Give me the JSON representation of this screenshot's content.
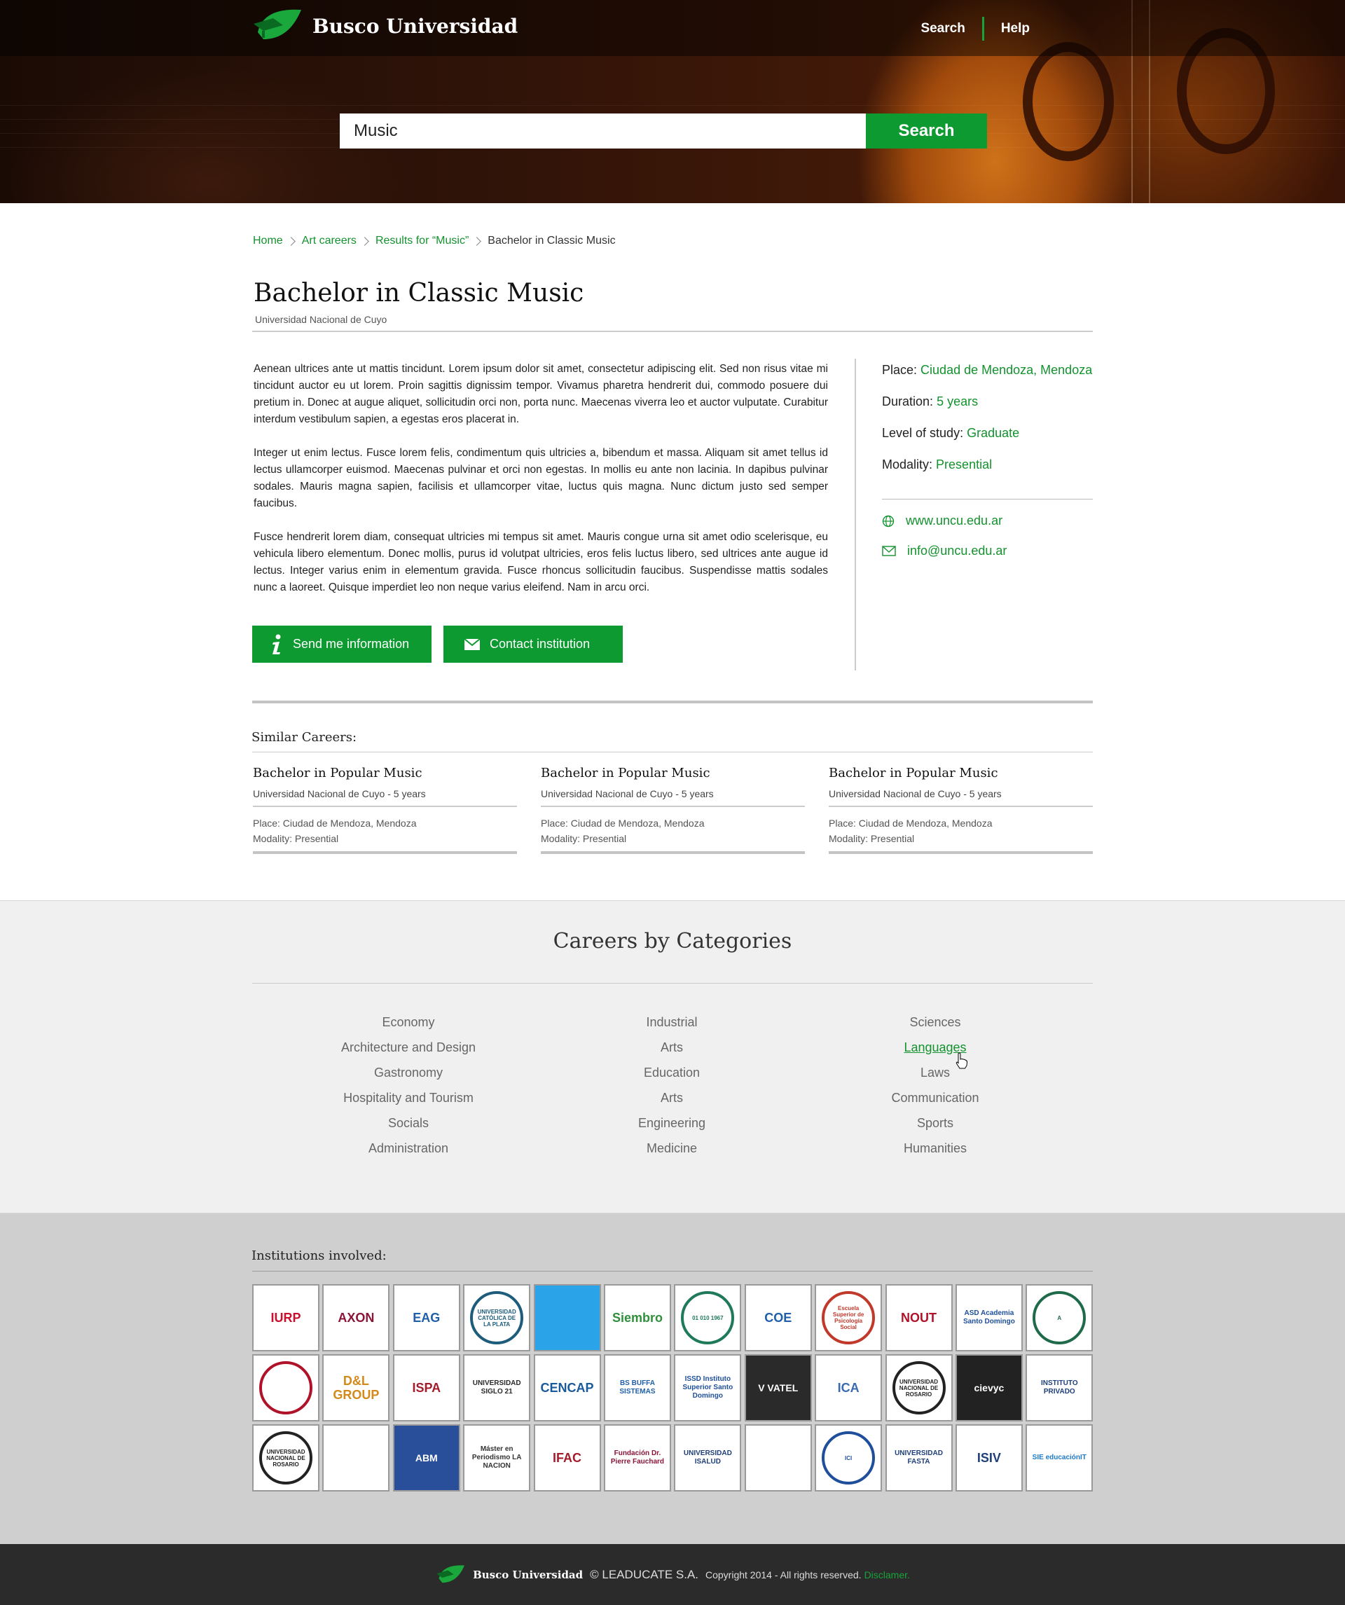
{
  "header": {
    "brand": "Busco Universidad",
    "nav": [
      "Search",
      "Help"
    ],
    "search_value": "Music",
    "search_button": "Search"
  },
  "breadcrumb": [
    "Home",
    "Art careers",
    "Results for “Music”",
    "Bachelor in Classic Music"
  ],
  "career": {
    "title": "Bachelor in Classic Music",
    "institution": "Universidad Nacional de Cuyo",
    "description": [
      "Aenean ultrices ante ut mattis tincidunt. Lorem ipsum dolor sit amet, consectetur adipiscing elit. Sed non risus vitae mi tincidunt auctor eu ut lorem. Proin sagittis dignissim tempor. Vivamus pharetra hendrerit dui, commodo posuere dui pretium in. Donec at augue aliquet, sollicitudin orci non, porta nunc. Maecenas viverra leo et auctor vulputate. Curabitur interdum vestibulum sapien, a egestas eros placerat in.",
      "Integer ut enim lectus. Fusce lorem felis, condimentum quis ultricies a, bibendum et massa. Aliquam sit amet tellus id lectus ullamcorper euismod. Maecenas pulvinar et orci non egestas. In mollis eu ante non lacinia. In dapibus pulvinar sodales. Mauris magna sapien, facilisis et ullamcorper vitae, luctus quis magna. Nunc dictum justo sed semper faucibus.",
      "Fusce hendrerit lorem diam, consequat ultricies mi tempus sit amet. Mauris congue urna sit amet odio scelerisque, eu vehicula libero elementum. Donec mollis, purus id volutpat ultricies, eros felis luctus libero, sed ultrices ante augue id lectus. Integer varius enim in elementum gravida. Fusce rhoncus sollicitudin faucibus. Suspendisse mattis sodales nunc a laoreet. Quisque imperdiet leo non neque varius eleifend. Nam in arcu orci."
    ],
    "buttons": {
      "send": "Send me information",
      "contact": "Contact institution"
    },
    "facts": [
      {
        "label": "Place:",
        "value": "Ciudad de Mendoza, Mendoza"
      },
      {
        "label": "Duration:",
        "value": "5 years"
      },
      {
        "label": "Level of study:",
        "value": "Graduate"
      },
      {
        "label": "Modality:",
        "value": "Presential"
      }
    ],
    "website": "www.uncu.edu.ar",
    "email": "info@uncu.edu.ar"
  },
  "similar": {
    "title": "Similar Careers:",
    "items": [
      {
        "title": "Bachelor in Popular Music",
        "sub": "Universidad Nacional de Cuyo - 5 years",
        "place": "Place: Ciudad de Mendoza, Mendoza",
        "modality": "Modality: Presential"
      },
      {
        "title": "Bachelor in Popular Music",
        "sub": "Universidad Nacional de Cuyo - 5 years",
        "place": "Place: Ciudad de Mendoza, Mendoza",
        "modality": "Modality: Presential"
      },
      {
        "title": "Bachelor in Popular Music",
        "sub": "Universidad Nacional de Cuyo - 5 years",
        "place": "Place: Ciudad de Mendoza, Mendoza",
        "modality": "Modality: Presential"
      }
    ]
  },
  "categories": {
    "title": "Careers by Categories",
    "columns": [
      [
        "Economy",
        "Architecture and Design",
        "Gastronomy",
        "Hospitality and Tourism",
        "Socials",
        "Administration"
      ],
      [
        "Industrial",
        "Arts",
        "Education",
        "Arts",
        "Engineering",
        "Medicine"
      ],
      [
        "Sciences",
        "Languages",
        "Laws",
        "Communication",
        "Sports",
        "Humanities"
      ]
    ],
    "active": "Languages"
  },
  "institutions": {
    "title": "Institutions involved:",
    "logos": [
      {
        "text": "IURP",
        "color": "#c8102e",
        "style": "plain"
      },
      {
        "text": "AXON",
        "color": "#8a1538",
        "style": "plain"
      },
      {
        "text": "EAG",
        "color": "#1f5fa8",
        "style": "plain"
      },
      {
        "text": "UNIVERSIDAD CATÓLICA DE LA PLATA",
        "color": "#1d5c7a",
        "style": "circle"
      },
      {
        "text": "",
        "color": "#2aa3e8",
        "style": "fill"
      },
      {
        "text": "Siembro",
        "color": "#2f8f3a",
        "style": "plain"
      },
      {
        "text": "01 010 1967",
        "color": "#1f7a5a",
        "style": "circle"
      },
      {
        "text": "COE",
        "color": "#1f5fa8",
        "style": "plain"
      },
      {
        "text": "Escuela Superior de Psicología Social",
        "color": "#c0392b",
        "style": "circle"
      },
      {
        "text": "NOUT",
        "color": "#b0122a",
        "style": "plain"
      },
      {
        "text": "ASD Academia Santo Domingo",
        "color": "#1f4f9a",
        "style": "plain"
      },
      {
        "text": "A",
        "color": "#1f6a4a",
        "style": "circle"
      },
      {
        "text": "",
        "color": "#b0122a",
        "style": "circle"
      },
      {
        "text": "D&L GROUP",
        "color": "#d48a1a",
        "style": "plain"
      },
      {
        "text": "ISPA",
        "color": "#a31c2c",
        "style": "plain"
      },
      {
        "text": "UNIVERSIDAD SIGLO 21",
        "color": "#2a2a2a",
        "style": "plain"
      },
      {
        "text": "CENCAP",
        "color": "#1a5a9a",
        "style": "plain"
      },
      {
        "text": "BS BUFFA SISTEMAS",
        "color": "#1f5fa8",
        "style": "plain"
      },
      {
        "text": "ISSD Instituto Superior Santo Domingo",
        "color": "#1f4f9a",
        "style": "plain"
      },
      {
        "text": "V VATEL",
        "color": "#2a2a2a",
        "style": "fill"
      },
      {
        "text": "ICA",
        "color": "#3a6ab0",
        "style": "plain"
      },
      {
        "text": "UNIVERSIDAD NACIONAL DE ROSARIO",
        "color": "#222222",
        "style": "circle"
      },
      {
        "text": "cievyc",
        "color": "#222222",
        "style": "fill"
      },
      {
        "text": "INSTITUTO PRIVADO",
        "color": "#1f3f7a",
        "style": "plain"
      },
      {
        "text": "UNIVERSIDAD NACIONAL DE ROSARIO",
        "color": "#222222",
        "style": "circle"
      },
      {
        "text": "",
        "color": "#1f3f7a",
        "style": "plain"
      },
      {
        "text": "ABM",
        "color": "#2a4f9a",
        "style": "fill"
      },
      {
        "text": "Máster en Periodismo LA NACION",
        "color": "#333333",
        "style": "plain"
      },
      {
        "text": "IFAC",
        "color": "#a31c2c",
        "style": "plain"
      },
      {
        "text": "Fundación Dr. Pierre Fauchard",
        "color": "#8a1538",
        "style": "plain"
      },
      {
        "text": "UNIVERSIDAD ISALUD",
        "color": "#1f3f7a",
        "style": "plain"
      },
      {
        "text": "",
        "color": "#1f3f7a",
        "style": "plain"
      },
      {
        "text": "ICI",
        "color": "#1f4f9a",
        "style": "circle"
      },
      {
        "text": "UNIVERSIDAD FASTA",
        "color": "#1f3f7a",
        "style": "plain"
      },
      {
        "text": "ISIV",
        "color": "#1f3f7a",
        "style": "plain"
      },
      {
        "text": "SIE educaciónIT",
        "color": "#1f7ac8",
        "style": "plain"
      }
    ]
  },
  "footer": {
    "brand": "Busco Universidad",
    "company": "© LEADUCATE S.A.",
    "rights": "Copyright 2014 - All rights reserved.",
    "disclaimer": "Disclamer."
  },
  "colors": {
    "accent": "#0d9a31",
    "link": "#13922e",
    "footer_bg": "#2b2b2b"
  }
}
